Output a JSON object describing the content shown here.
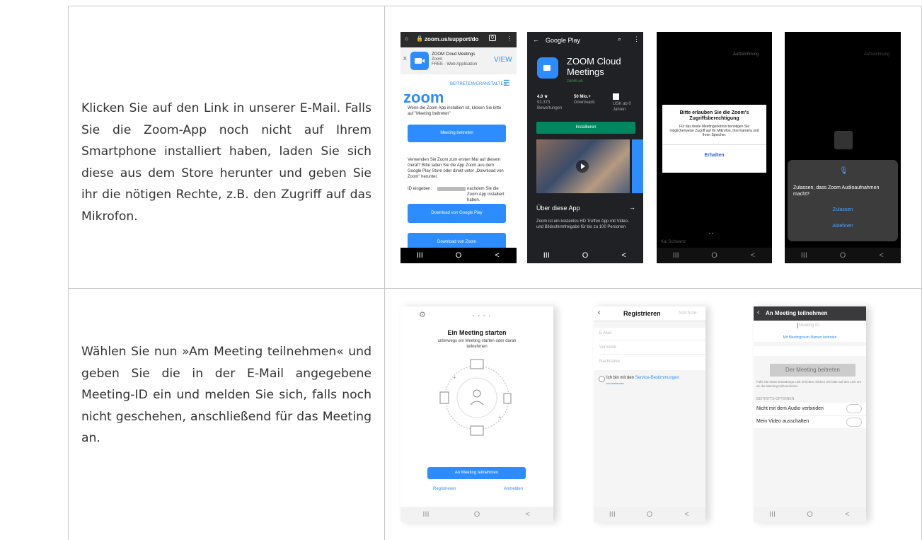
{
  "rows": [
    {
      "text": "Klicken Sie auf den Link in unserer E-Mail. Falls Sie die Zoom-App noch nicht auf Ihrem Smartphone installiert haben, laden Sie sich diese aus dem Store herunter und geben Sie ihr die nötigen Rechte, z.B. den Zugriff auf das Mikrofon."
    },
    {
      "text": "Wählen Sie nun »Am Meeting teilnehmen« und geben Sie die in der E-Mail angegebene Meeting-ID ein und melden Sie sich, falls noch nicht geschehen, anschließend für das Meeting an."
    }
  ],
  "phone1": {
    "url": "zoom.us/support/do",
    "tab_count": "0",
    "banner_title": "ZOOM Cloud Meetings",
    "banner_sub1": "Zoom",
    "banner_sub2": "FREE - Web Application",
    "banner_view": "VIEW",
    "banner_close": "X",
    "nav_join": "BEITRETEN",
    "nav_host": "VERANSTALTEN",
    "logo": "zoom",
    "intro": "Wenn die Zoom App installiert ist, klicken Sie bitte auf \"Meeting beitreten\"",
    "meeting_btn": "Meeting beitreten",
    "first_time": "Verwenden Sie Zoom zum ersten Mal auf diesem Gerät? Bitte laden Sie die App Zoom aus dem Google Play Store oder direkt unter „Download von Zoom\" herunter.",
    "id_label": "ID eingeben:",
    "id_suffix": "nachdem Sie die Zoom App installiert haben.",
    "download_gp": "Download von Google Play",
    "download_zoom": "Download von Zoom"
  },
  "phone2": {
    "header": "Google Play",
    "app_name_1": "ZOOM Cloud",
    "app_name_2": "Meetings",
    "developer": "zoom.us",
    "rating": "4,0 ★",
    "reviews": "92.373 Bewertungen",
    "downloads": "50 Mio.+",
    "downloads_label": "Downloads",
    "usk": "USK ab 0 Jahren",
    "install": "Installieren",
    "about": "Über diese App",
    "about_arrow": "→",
    "desc": "Zoom ist ein kostenlos HD Treffen App mit Video- und Bildschirmfreigabe für bis zu 100 Personen"
  },
  "phone3": {
    "top_label": "Aufzeichnung",
    "dialog_title": "Bitte erlauben Sie die Zoom's Zugriffsberechtigung",
    "dialog_body": "Für das beste Meetingerlebnis benötigen Sie möglicherweise Zugriff auf Ihr Mikrofon, Ihre Kamera und Ihren Speicher.",
    "dialog_btn": "Erhalten",
    "bottom_name": "Kai Schwartz",
    "dots": "• •"
  },
  "phone4": {
    "top_label": "Aufzeichnung",
    "question": "Zulassen, dass Zoom Audioaufnahmen macht?",
    "allow": "Zulassen",
    "deny": "Ablehnen"
  },
  "phone5": {
    "dots": "● ● ● ●",
    "title": "Ein Meeting starten",
    "subtitle": "unterwegs ein Meeting starten oder daran teilnehmen",
    "join_btn": "An Meeting teilnehmen",
    "register": "Registrieren",
    "login": "Anmelden"
  },
  "phone6": {
    "title": "Registrieren",
    "next": "Nächste",
    "email": "E-Mail",
    "firstname": "Vorname",
    "lastname": "Nachname",
    "terms_prefix": "Ich bin mit den ",
    "terms_link": "Service-Bestimmungen",
    "terms_sub": "einverstanden"
  },
  "phone7": {
    "title": "An Meeting teilnehmen",
    "meeting_id": "Meeting ID",
    "room_link": "Mit Meetingraum-Namen beitreten",
    "join_btn": "Der Meeting beitreten",
    "hint": "Falls Sie einen Einladungs Link erhielten, klicken Sie bitte auf den Link um an der Meeting teilzunehmen.",
    "options": "BEITRITTS-OPTIONEN",
    "no_audio": "Nicht mit dem Audio verbinden",
    "no_video": "Mein Video ausschalten"
  },
  "nav": {
    "recent": "III",
    "home": "O",
    "back": "<"
  }
}
